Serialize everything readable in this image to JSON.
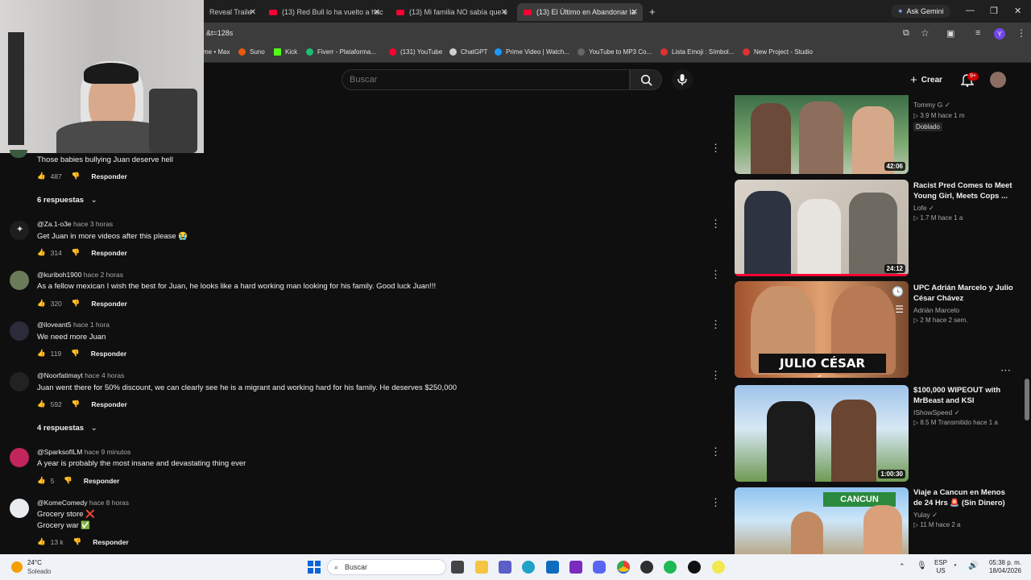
{
  "browser": {
    "tabs": [
      {
        "label": "Reveal Traile"
      },
      {
        "label": "(13) Red Bull lo ha vuelto a hac"
      },
      {
        "label": "(13) Mi familia NO sabía que e"
      },
      {
        "label": "(13) El Último en Abandonar la"
      }
    ],
    "ask_gemini": "Ask Gemini",
    "url": "&t=128s",
    "bookmarks": [
      {
        "label": "me • Max",
        "color": "#4c6ef5"
      },
      {
        "label": "Suno",
        "color": "#e8590c"
      },
      {
        "label": "Kick",
        "color": "#53fc18"
      },
      {
        "label": "Fiverr - Plataforma...",
        "color": "#1dbf73"
      },
      {
        "label": "(131) YouTube",
        "color": "#ff0033"
      },
      {
        "label": "ChatGPT",
        "color": "#d0d0d0"
      },
      {
        "label": "Prime Video | Watch...",
        "color": "#1a98ff"
      },
      {
        "label": "YouTube to MP3 Co...",
        "color": "#666666"
      },
      {
        "label": "Lista Emoji : Símbol...",
        "color": "#e03131"
      },
      {
        "label": "New Project - Studio",
        "color": "#e03131"
      }
    ]
  },
  "youtube": {
    "search_placeholder": "Buscar",
    "create_label": "Crear",
    "notif_badge": "9+"
  },
  "comments": [
    {
      "user": "",
      "time": "",
      "text": "Those babies bullying Juan deserve hell",
      "likes": "487",
      "reply": "Responder",
      "replies": "6 respuestas",
      "avatar_color": "#3a5a40"
    },
    {
      "user": "@Za.1-o3e",
      "time": "hace 3 horas",
      "text": "Get Juan in more videos after this please 😭",
      "likes": "314",
      "reply": "Responder",
      "replies": "",
      "avatar_color": "#1e1e1e"
    },
    {
      "user": "@kuriboh1900",
      "time": "hace 2 horas",
      "text": "As a fellow mexican I wish the best for Juan, he looks like a hard working man looking for his family. Good luck Juan!!!",
      "likes": "320",
      "reply": "Responder",
      "replies": "",
      "avatar_color": "#6b7b5a"
    },
    {
      "user": "@iloveant5",
      "time": "hace 1 hora",
      "text": "We need more Juan",
      "likes": "119",
      "reply": "Responder",
      "replies": "",
      "avatar_color": "#2b2b3a"
    },
    {
      "user": "@Noorfatimayt",
      "time": "hace 4 horas",
      "text": "Juan went there for 50% discount, we can clearly see he is a migrant and working hard for his family. He deserves $250,000",
      "likes": "592",
      "reply": "Responder",
      "replies": "4 respuestas",
      "avatar_color": "#222222"
    },
    {
      "user": "@SparksofILM",
      "time": "hace 9 minutos",
      "text": "A year is probably the most insane and devastating thing ever",
      "likes": "5",
      "reply": "Responder",
      "replies": "",
      "avatar_color": "#c2255c"
    },
    {
      "user": "@KomeComedy",
      "time": "hace 8 horas",
      "text": "Grocery store ❌",
      "text2": "Grocery war ✅",
      "likes": "13 k",
      "reply": "Responder",
      "replies": "",
      "avatar_color": "#e9ecef"
    }
  ],
  "sidebar": [
    {
      "title": "",
      "channel": "Tommy G ✓",
      "meta": "▷ 3.9 M  hace 1 m",
      "badge": "Doblado",
      "duration": "42:06"
    },
    {
      "title": "Racist Pred Comes to Meet Young Girl, Meets Cops ...",
      "channel": "Lofe ✓",
      "meta": "▷ 1.7 M  hace 1 a",
      "badge": "",
      "duration": "24:12"
    },
    {
      "title": "UPC Adrián Marcelo y Julio César Chávez",
      "channel": "Adrián Marcelo",
      "meta": "▷ 2 M  hace 2 sem.",
      "badge": "",
      "duration": "",
      "thumb_text": "JULIO CÉSAR CHÁVEZ"
    },
    {
      "title": "$100,000 WIPEOUT with MrBeast and KSI",
      "channel": "IShowSpeed ✓",
      "meta": "▷ 8.5 M  Transmitido hace 1 a",
      "badge": "",
      "duration": "1:00:30"
    },
    {
      "title": "Viaje a Cancun en Menos de 24 Hrs 🚨 (Sin Dinero)",
      "channel": "Yulay ✓",
      "meta": "▷ 11 M  hace 2 a",
      "badge": "",
      "duration": "",
      "thumb_text": "CANCUN"
    }
  ],
  "taskbar": {
    "weather_temp": "24°C",
    "weather_desc": "Soleado",
    "search_label": "Buscar",
    "lang1": "ESP",
    "lang2": "US",
    "time": "05:38 p. m.",
    "date": "18/04/2026"
  }
}
